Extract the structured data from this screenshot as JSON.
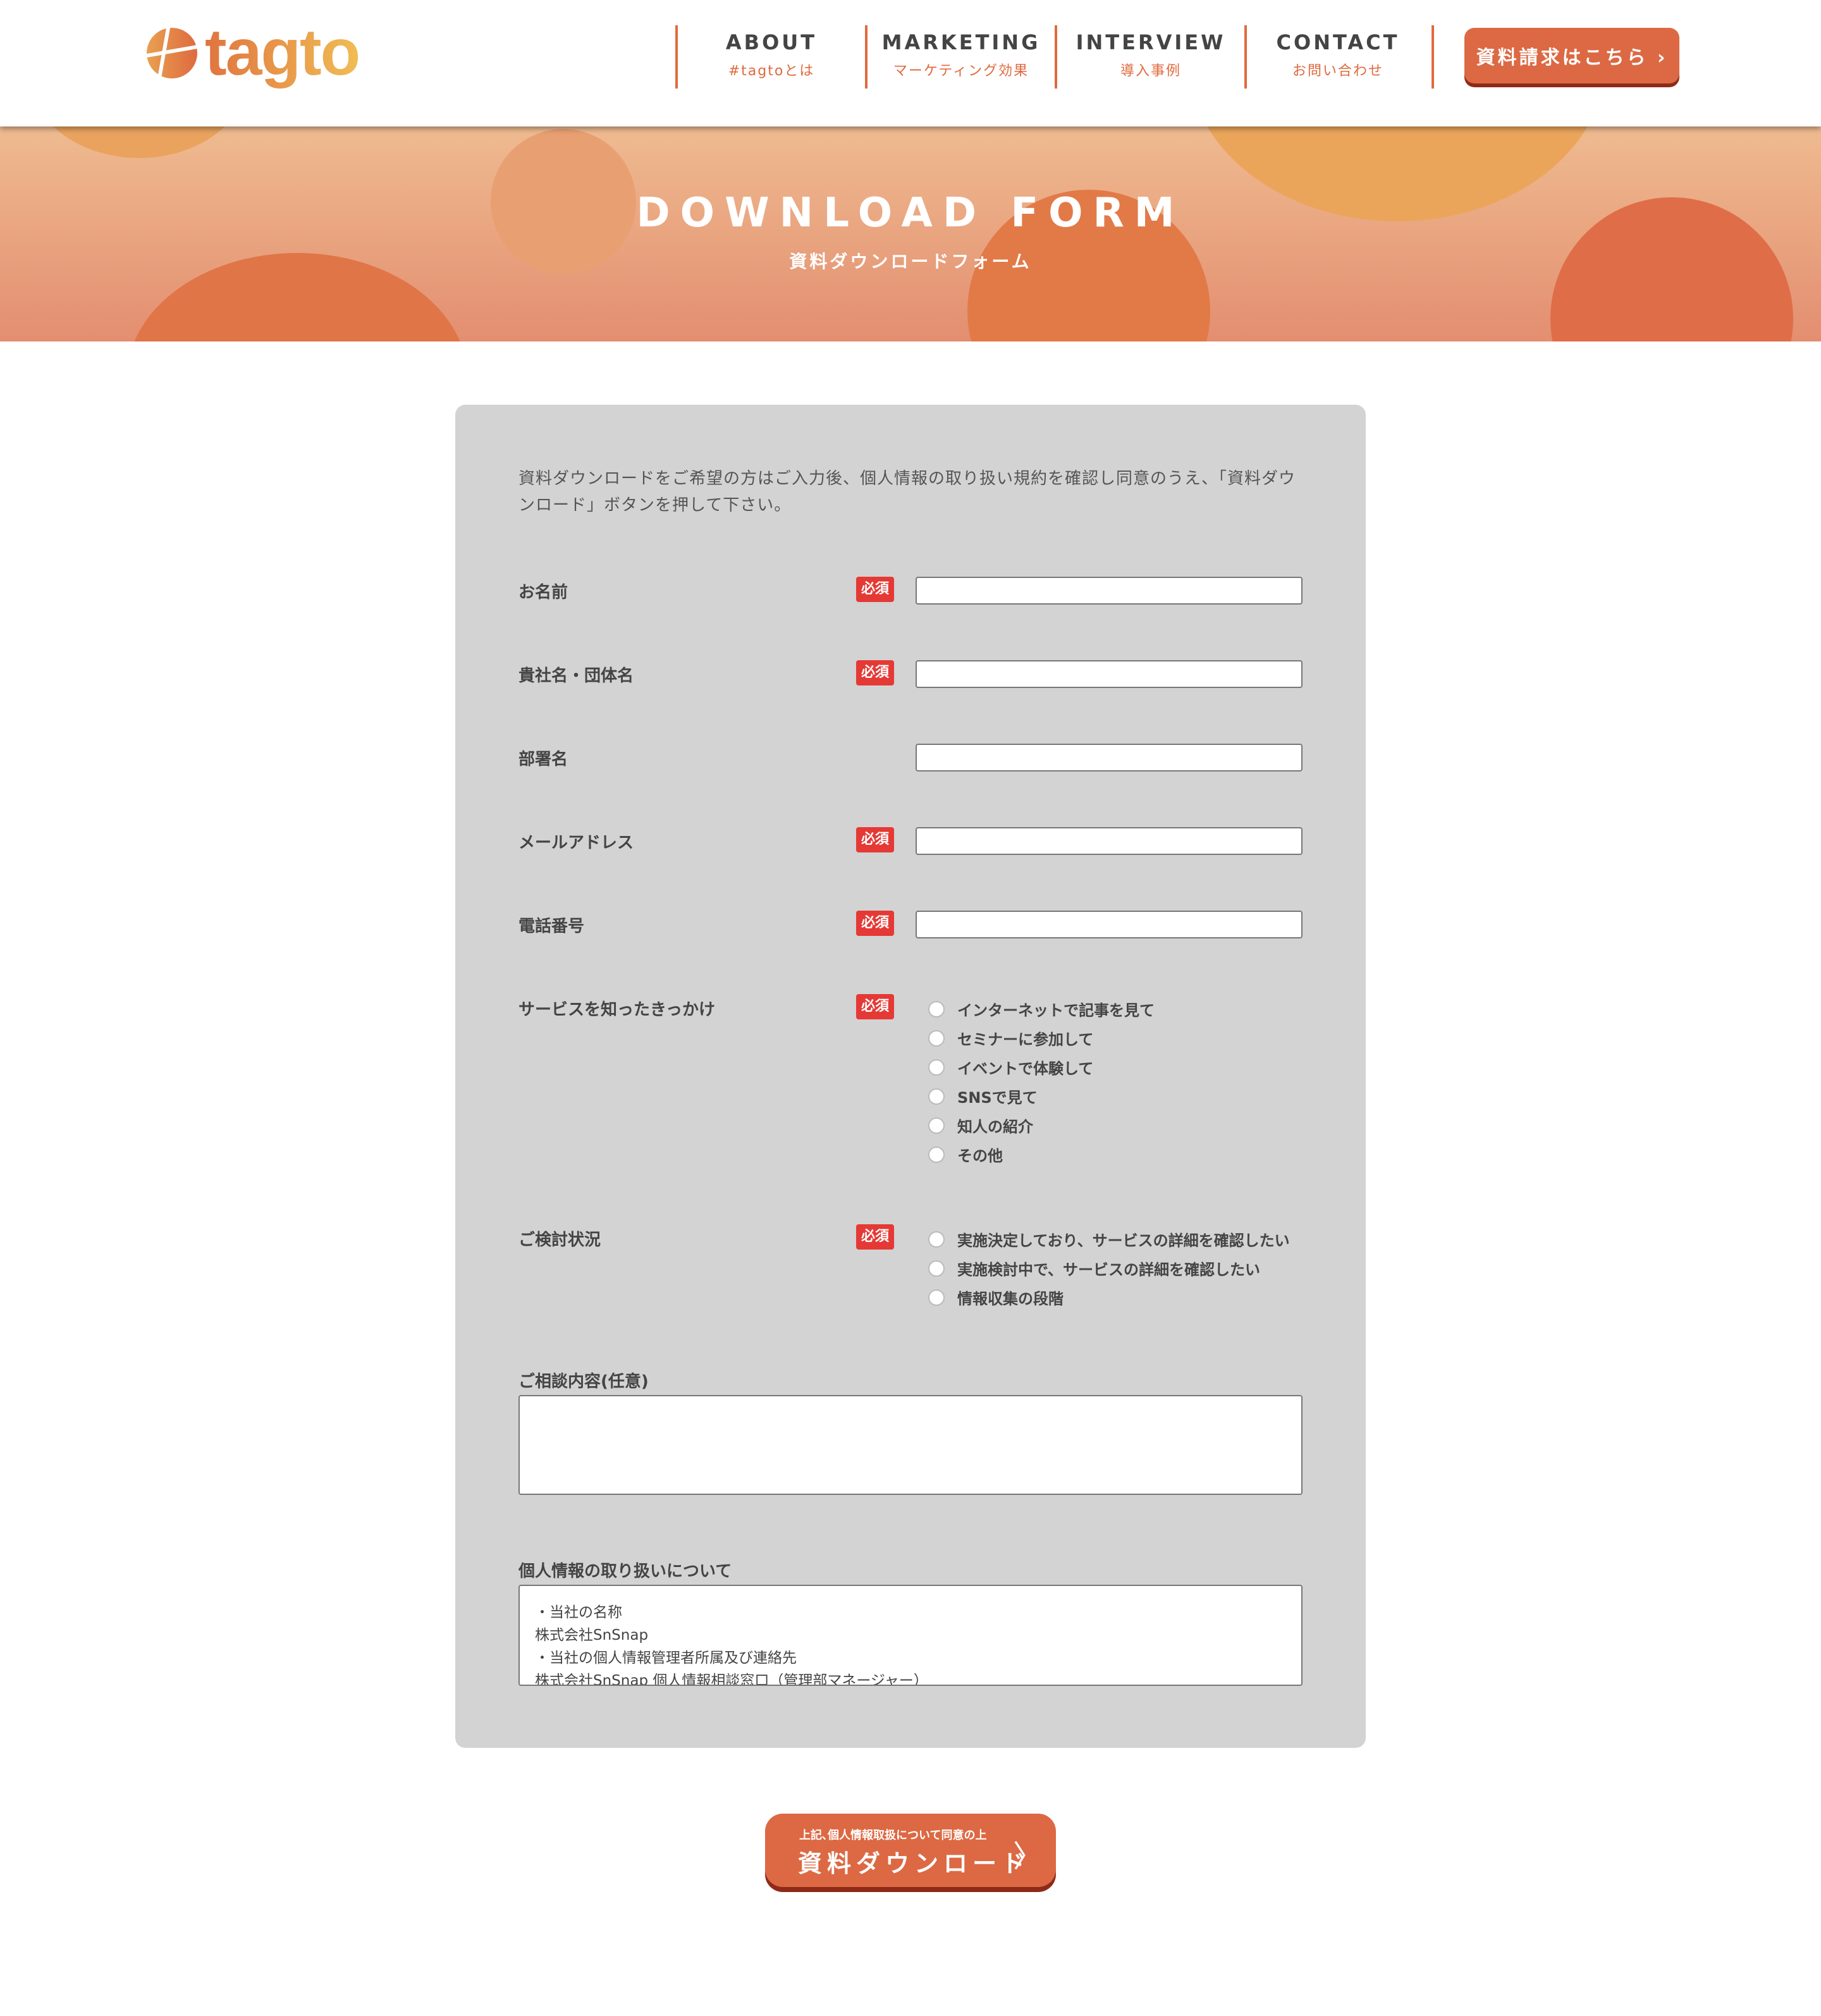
{
  "header": {
    "logo": "tagto",
    "nav": [
      {
        "en": "ABOUT",
        "jp": "#tagtoとは"
      },
      {
        "en": "MARKETING",
        "jp": "マーケティング効果"
      },
      {
        "en": "INTERVIEW",
        "jp": "導入事例"
      },
      {
        "en": "CONTACT",
        "jp": "お問い合わせ"
      }
    ],
    "cta": "資料請求はこちら ›"
  },
  "hero": {
    "title": "DOWNLOAD FORM",
    "subtitle": "資料ダウンロードフォーム"
  },
  "form": {
    "intro": "資料ダウンロードをご希望の方はご入力後、個人情報の取り扱い規約を確認し同意のうえ、「資料ダウンロード」ボタンを押して下さい。",
    "required": "必須",
    "fields": [
      {
        "label": "お名前",
        "required": true
      },
      {
        "label": "貴社名・団体名",
        "required": true
      },
      {
        "label": "部署名",
        "required": false
      },
      {
        "label": "メールアドレス",
        "required": true
      },
      {
        "label": "電話番号",
        "required": true
      }
    ],
    "trigger": {
      "label": "サービスを知ったきっかけ",
      "options": [
        "インターネットで記事を見て",
        "セミナーに参加して",
        "イベントで体験して",
        "SNSで見て",
        "知人の紹介",
        "その他"
      ]
    },
    "status": {
      "label": "ご検討状況",
      "options": [
        "実施決定しており、サービスの詳細を確認したい",
        "実施検討中で、サービスの詳細を確認したい",
        "情報収集の段階"
      ]
    },
    "consult": {
      "label": "ご相談内容(任意)"
    },
    "privacy": {
      "label": "個人情報の取り扱いについて",
      "lines": [
        "・当社の名称",
        "株式会社SnSnap",
        "・当社の個人情報管理者所属及び連絡先",
        "株式会社SnSnap 個人情報相談窓口（管理部マネージャー）"
      ]
    }
  },
  "submit": {
    "sub": "上記､個人情報取扱について同意の上",
    "main": "資料ダウンロード",
    "chevron": "〉"
  },
  "colors": {
    "accent": "#dc6943",
    "required": "#e53935",
    "panel": "#d3d3d3"
  }
}
